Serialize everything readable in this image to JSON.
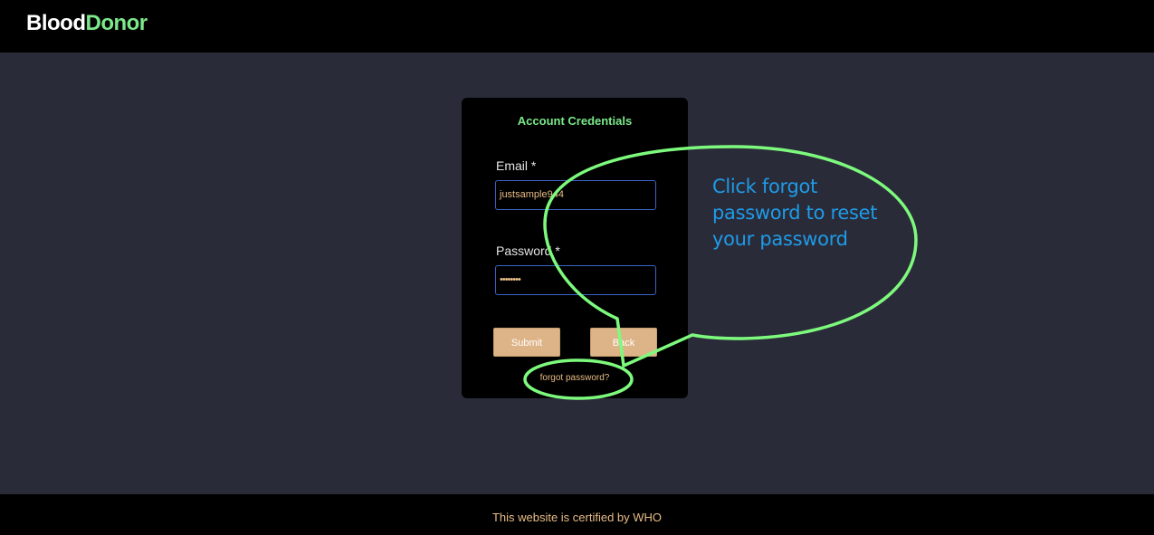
{
  "brand": {
    "part1": "Blood",
    "part2": "Donor"
  },
  "form": {
    "title": "Account Credentials",
    "email_label": "Email *",
    "email_value": "justsample944",
    "password_label": "Password *",
    "password_value": "••••••••",
    "submit_label": "Submit",
    "back_label": "Back",
    "forgot_label": "forgot password?"
  },
  "annotation": {
    "text": "Click forgot password to reset your password"
  },
  "footer": {
    "text": "This website is certified by WHO"
  },
  "colors": {
    "page_bg": "#2a2b38",
    "brand_accent": "#7be88a",
    "button_bg": "#ddb487",
    "annotation_stroke": "#7dfa7d",
    "annotation_text": "#1e9be8"
  }
}
